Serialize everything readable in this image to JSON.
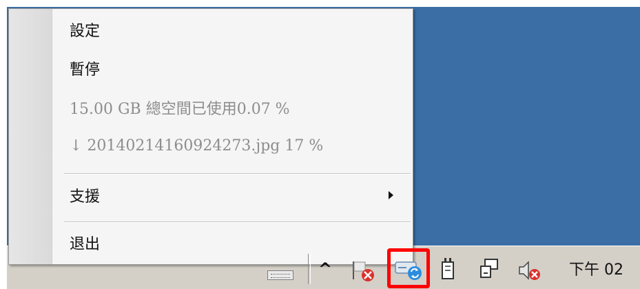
{
  "context_menu": {
    "items": [
      {
        "label": "設定",
        "enabled": true
      },
      {
        "label": "暫停",
        "enabled": true
      },
      {
        "label": "15.00 GB 總空間已使用0.07 %",
        "enabled": false
      },
      {
        "label": "↓ 20140214160924273.jpg 17 %",
        "enabled": false
      },
      {
        "label": "支援",
        "enabled": true,
        "has_submenu": true
      },
      {
        "label": "退出",
        "enabled": true
      }
    ]
  },
  "taskbar": {
    "tray_icons": [
      "keyboard-icon",
      "show-hidden-icons-chevron",
      "action-center-flag-icon",
      "cloud-sync-icon",
      "power-icon",
      "network-icon",
      "volume-muted-icon"
    ],
    "chevron_label": "^",
    "clock": "下午 02"
  },
  "colors": {
    "desktop": "#3b6ea5",
    "taskbar": "#d4d0c8",
    "highlight": "#ff0000",
    "menu_background": "#f5f5f5",
    "disabled_text": "#8d8d8d"
  }
}
